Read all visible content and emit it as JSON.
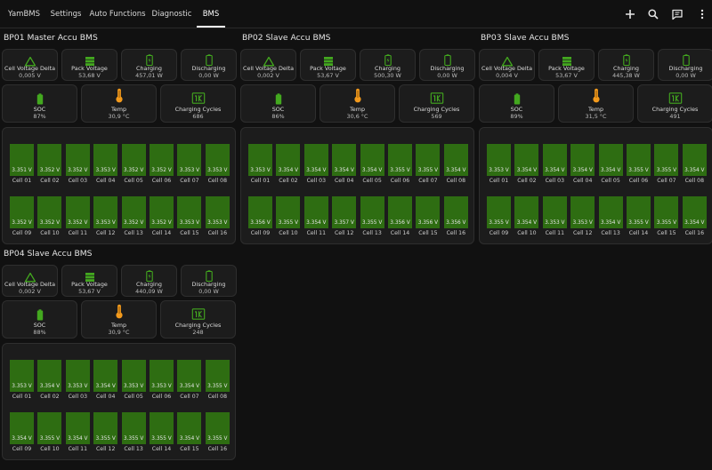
{
  "nav": {
    "tabs": [
      {
        "label": "YamBMS"
      },
      {
        "label": "Settings"
      },
      {
        "label": "Auto Functions"
      },
      {
        "label": "Diagnostic"
      },
      {
        "label": "BMS"
      }
    ],
    "active_tab": "BMS",
    "icons": [
      "plus-icon",
      "search-icon",
      "comment-icon",
      "more-vertical-icon"
    ]
  },
  "metric_labels": {
    "voltage_delta": "Cell Voltage Delta",
    "pack_voltage": "Pack Voltage",
    "charging": "Charging",
    "discharging": "Discharging",
    "soc": "SOC",
    "temp": "Temp",
    "cycles": "Charging Cycles"
  },
  "colors": {
    "icon_green": "#43a81f",
    "temp_orange": "#f39a1c",
    "cell_bar": "#2e6d12",
    "background": "#111111",
    "card": "#1c1c1c"
  },
  "bms": [
    {
      "title": "BP01 Master Accu BMS",
      "voltage_delta": "0,005 V",
      "pack_voltage": "53,68 V",
      "charging": "457,01 W",
      "discharging": "0,00 W",
      "soc": "87%",
      "temp": "30,9 °C",
      "cycles": "686",
      "cells": [
        {
          "name": "Cell 01",
          "value": "3.351 V"
        },
        {
          "name": "Cell 02",
          "value": "3.352 V"
        },
        {
          "name": "Cell 03",
          "value": "3.352 V"
        },
        {
          "name": "Cell 04",
          "value": "3.353 V"
        },
        {
          "name": "Cell 05",
          "value": "3.352 V"
        },
        {
          "name": "Cell 06",
          "value": "3.352 V"
        },
        {
          "name": "Cell 07",
          "value": "3.353 V"
        },
        {
          "name": "Cell 08",
          "value": "3.353 V"
        },
        {
          "name": "Cell 09",
          "value": "3.352 V"
        },
        {
          "name": "Cell 10",
          "value": "3.352 V"
        },
        {
          "name": "Cell 11",
          "value": "3.352 V"
        },
        {
          "name": "Cell 12",
          "value": "3.353 V"
        },
        {
          "name": "Cell 13",
          "value": "3.352 V"
        },
        {
          "name": "Cell 14",
          "value": "3.352 V"
        },
        {
          "name": "Cell 15",
          "value": "3.353 V"
        },
        {
          "name": "Cell 16",
          "value": "3.353 V"
        }
      ]
    },
    {
      "title": "BP02 Slave Accu BMS",
      "voltage_delta": "0,002 V",
      "pack_voltage": "53,67 V",
      "charging": "500,30 W",
      "discharging": "0,00 W",
      "soc": "86%",
      "temp": "30,6 °C",
      "cycles": "569",
      "cells": [
        {
          "name": "Cell 01",
          "value": "3.353 V"
        },
        {
          "name": "Cell 02",
          "value": "3.354 V"
        },
        {
          "name": "Cell 03",
          "value": "3.354 V"
        },
        {
          "name": "Cell 04",
          "value": "3.354 V"
        },
        {
          "name": "Cell 05",
          "value": "3.354 V"
        },
        {
          "name": "Cell 06",
          "value": "3.355 V"
        },
        {
          "name": "Cell 07",
          "value": "3.355 V"
        },
        {
          "name": "Cell 08",
          "value": "3.354 V"
        },
        {
          "name": "Cell 09",
          "value": "3.356 V"
        },
        {
          "name": "Cell 10",
          "value": "3.355 V"
        },
        {
          "name": "Cell 11",
          "value": "3.354 V"
        },
        {
          "name": "Cell 12",
          "value": "3.357 V"
        },
        {
          "name": "Cell 13",
          "value": "3.355 V"
        },
        {
          "name": "Cell 14",
          "value": "3.356 V"
        },
        {
          "name": "Cell 15",
          "value": "3.356 V"
        },
        {
          "name": "Cell 16",
          "value": "3.356 V"
        }
      ]
    },
    {
      "title": "BP03 Slave Accu BMS",
      "voltage_delta": "0,004 V",
      "pack_voltage": "53,67 V",
      "charging": "445,38 W",
      "discharging": "0,00 W",
      "soc": "89%",
      "temp": "31,5 °C",
      "cycles": "491",
      "cells": [
        {
          "name": "Cell 01",
          "value": "3.353 V"
        },
        {
          "name": "Cell 02",
          "value": "3.354 V"
        },
        {
          "name": "Cell 03",
          "value": "3.354 V"
        },
        {
          "name": "Cell 04",
          "value": "3.354 V"
        },
        {
          "name": "Cell 05",
          "value": "3.354 V"
        },
        {
          "name": "Cell 06",
          "value": "3.355 V"
        },
        {
          "name": "Cell 07",
          "value": "3.355 V"
        },
        {
          "name": "Cell 08",
          "value": "3.354 V"
        },
        {
          "name": "Cell 09",
          "value": "3.355 V"
        },
        {
          "name": "Cell 10",
          "value": "3.354 V"
        },
        {
          "name": "Cell 11",
          "value": "3.353 V"
        },
        {
          "name": "Cell 12",
          "value": "3.353 V"
        },
        {
          "name": "Cell 13",
          "value": "3.354 V"
        },
        {
          "name": "Cell 14",
          "value": "3.355 V"
        },
        {
          "name": "Cell 15",
          "value": "3.355 V"
        },
        {
          "name": "Cell 16",
          "value": "3.354 V"
        }
      ]
    },
    {
      "title": "BP04 Slave Accu BMS",
      "voltage_delta": "0,002 V",
      "pack_voltage": "53,67 V",
      "charging": "440,09 W",
      "discharging": "0,00 W",
      "soc": "88%",
      "temp": "30,9 °C",
      "cycles": "248",
      "cells": [
        {
          "name": "Cell 01",
          "value": "3.353 V"
        },
        {
          "name": "Cell 02",
          "value": "3.354 V"
        },
        {
          "name": "Cell 03",
          "value": "3.353 V"
        },
        {
          "name": "Cell 04",
          "value": "3.354 V"
        },
        {
          "name": "Cell 05",
          "value": "3.353 V"
        },
        {
          "name": "Cell 06",
          "value": "3.353 V"
        },
        {
          "name": "Cell 07",
          "value": "3.354 V"
        },
        {
          "name": "Cell 08",
          "value": "3.355 V"
        },
        {
          "name": "Cell 09",
          "value": "3.354 V"
        },
        {
          "name": "Cell 10",
          "value": "3.355 V"
        },
        {
          "name": "Cell 11",
          "value": "3.354 V"
        },
        {
          "name": "Cell 12",
          "value": "3.355 V"
        },
        {
          "name": "Cell 13",
          "value": "3.355 V"
        },
        {
          "name": "Cell 14",
          "value": "3.355 V"
        },
        {
          "name": "Cell 15",
          "value": "3.354 V"
        },
        {
          "name": "Cell 16",
          "value": "3.355 V"
        }
      ]
    }
  ]
}
